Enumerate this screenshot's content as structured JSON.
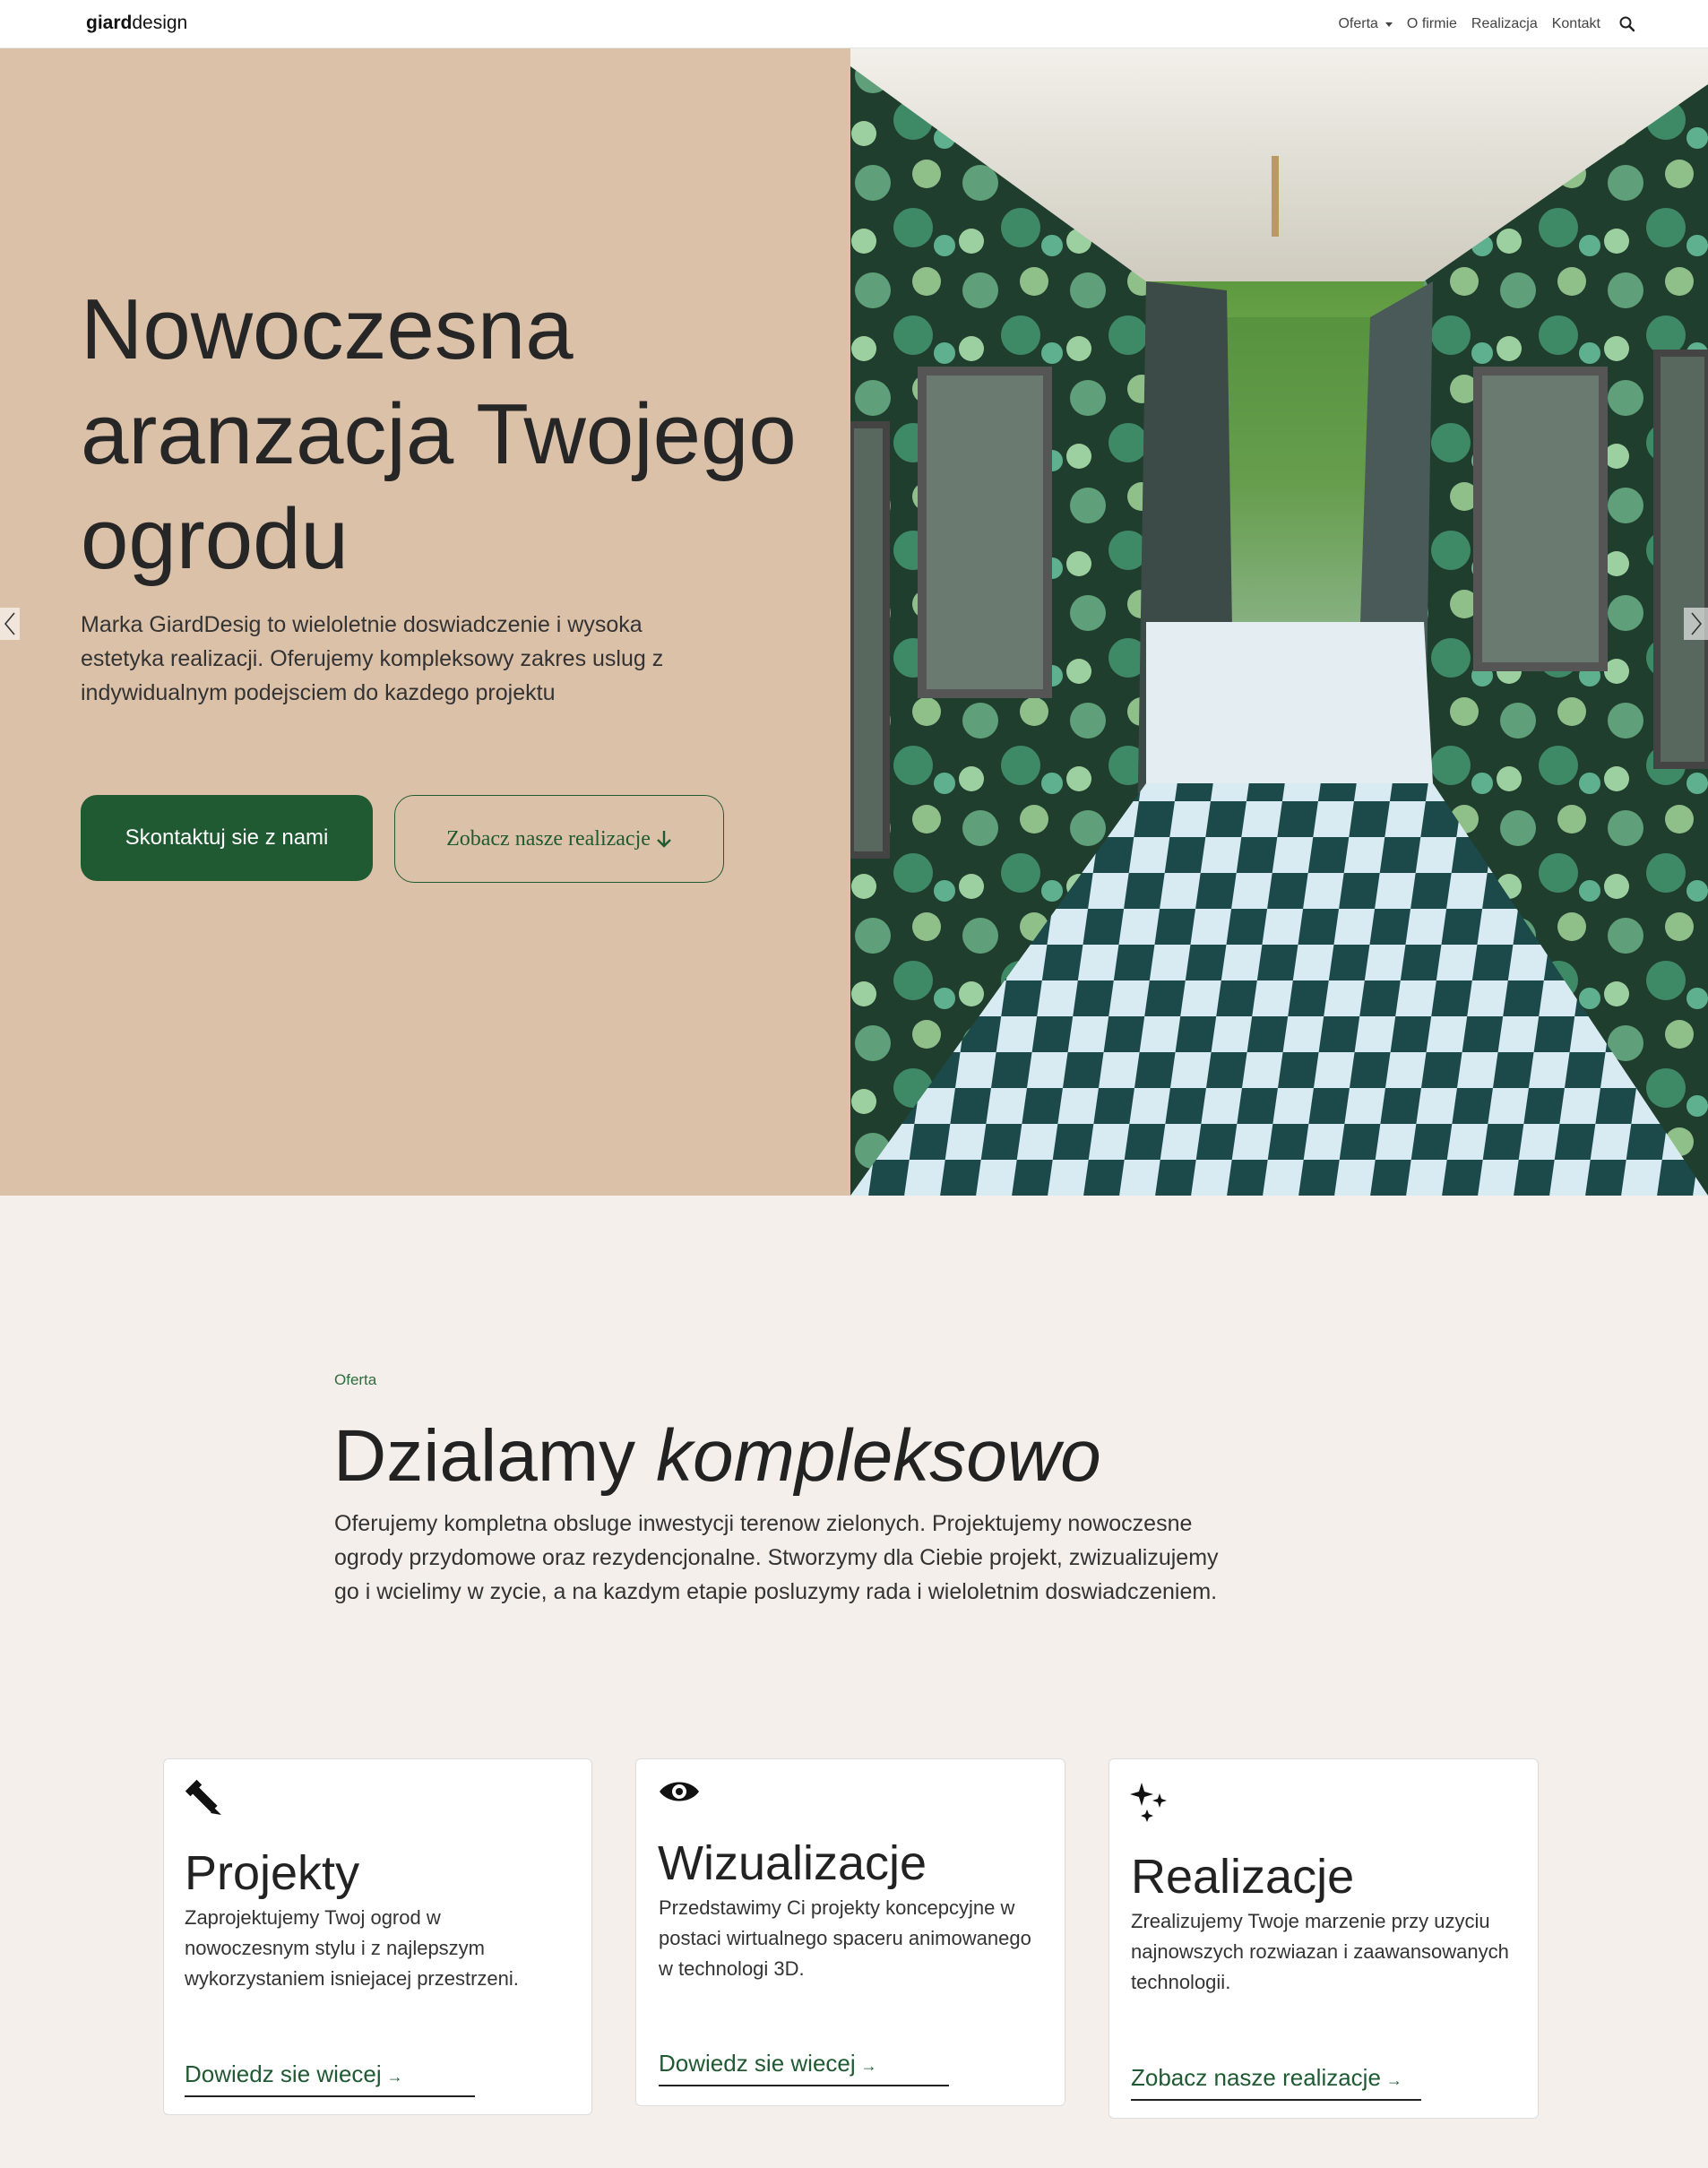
{
  "navbar": {
    "logo_bold": "giard",
    "logo_rest": "design",
    "items": [
      {
        "label": "Oferta",
        "has_dropdown": true
      },
      {
        "label": "O firmie"
      },
      {
        "label": "Realizacja"
      },
      {
        "label": "Kontakt"
      }
    ],
    "search_icon": "search-icon"
  },
  "hero": {
    "title": "Nowoczesna aranzacja Twojego ogrodu",
    "description": "Marka GiardDesig to wieloletnie doswiadczenie i wysoka estetyka realizacji. Oferujemy kompleksowy zakres uslug z indywidualnym podejsciem do kazdego projektu",
    "primary_button": "Skontaktuj sie z nami",
    "secondary_button": "Zobacz nasze realizacje",
    "background_color": "#dcc1a9",
    "image": "garden-corridor-checkered-floor"
  },
  "offer": {
    "eyebrow": "Oferta",
    "title_regular": "Dzialamy",
    "title_italic": "kompleksowo",
    "description": "Oferujemy kompletna obsluge inwestycji terenow zielonych. Projektujemy nowoczesne ogrody przydomowe oraz rezydencjonalne. Stworzymy dla Ciebie projekt, zwizualizujemy go i wcielimy w zycie, a na kazdym etapie posluzymy rada i wieloletnim doswiadczeniem.",
    "cards": [
      {
        "icon": "pencil-ruler-icon",
        "title": "Projekty",
        "description": "Zaprojektujemy Twoj ogrod w nowoczesnym stylu i z najlepszym wykorzystaniem isniejacej przestrzeni.",
        "link": "Dowiedz sie wiecej"
      },
      {
        "icon": "eye-icon",
        "title": "Wizualizacje",
        "description": "Przedstawimy Ci projekty koncepcyjne w postaci wirtualnego spaceru animowanego w technologi 3D.",
        "link": "Dowiedz sie wiecej"
      },
      {
        "icon": "sparkles-icon",
        "title": "Realizacje",
        "description": "Zrealizujemy Twoje marzenie przy uzyciu najnowszych rozwiazan i zaawansowanych technologii.",
        "link": "Zobacz nasze realizacje"
      }
    ]
  },
  "colors": {
    "accent_green": "#1f5a32",
    "hero_beige": "#dcc1a9",
    "section_bg": "#f4efea"
  }
}
